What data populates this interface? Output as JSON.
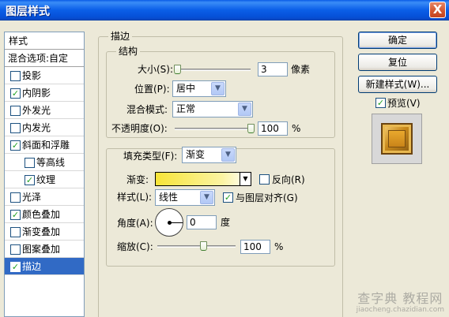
{
  "window": {
    "title": "图层样式",
    "close_glyph": "X"
  },
  "styles_panel": {
    "header": "样式",
    "blend_options": "混合选项:自定",
    "items": [
      {
        "label": "投影",
        "checked": false,
        "sub": false,
        "selected": false
      },
      {
        "label": "内阴影",
        "checked": true,
        "sub": false,
        "selected": false
      },
      {
        "label": "外发光",
        "checked": false,
        "sub": false,
        "selected": false
      },
      {
        "label": "内发光",
        "checked": false,
        "sub": false,
        "selected": false
      },
      {
        "label": "斜面和浮雕",
        "checked": true,
        "sub": false,
        "selected": false
      },
      {
        "label": "等高线",
        "checked": false,
        "sub": true,
        "selected": false
      },
      {
        "label": "纹理",
        "checked": true,
        "sub": true,
        "selected": false
      },
      {
        "label": "光泽",
        "checked": false,
        "sub": false,
        "selected": false
      },
      {
        "label": "颜色叠加",
        "checked": true,
        "sub": false,
        "selected": false
      },
      {
        "label": "渐变叠加",
        "checked": false,
        "sub": false,
        "selected": false
      },
      {
        "label": "图案叠加",
        "checked": false,
        "sub": false,
        "selected": false
      },
      {
        "label": "描边",
        "checked": true,
        "sub": false,
        "selected": true
      }
    ]
  },
  "stroke": {
    "title": "描边",
    "structure": {
      "title": "结构",
      "size_label": "大小(S):",
      "size_value": "3",
      "size_unit": "像素",
      "size_level": 0.02,
      "position_label": "位置(P):",
      "position_value": "居中",
      "blend_label": "混合模式:",
      "blend_value": "正常",
      "opacity_label": "不透明度(O):",
      "opacity_value": "100",
      "opacity_unit": "%",
      "opacity_level": 1.0
    },
    "fill": {
      "type_label": "填充类型(F):",
      "type_value": "渐变",
      "gradient_label": "渐变:",
      "reverse_label": "反向(R)",
      "reverse_checked": false,
      "style_label": "样式(L):",
      "style_value": "线性",
      "align_label": "与图层对齐(G)",
      "align_checked": true,
      "angle_label": "角度(A):",
      "angle_value": "0",
      "angle_unit": "度",
      "scale_label": "缩放(C):",
      "scale_value": "100",
      "scale_unit": "%",
      "scale_level": 0.6
    }
  },
  "buttons": {
    "ok": "确定",
    "reset": "复位",
    "new_style": "新建样式(W)...",
    "preview_label": "预览(V)",
    "preview_checked": true
  },
  "watermark": {
    "main": "查字典 教程网",
    "sub": "jiaocheng.chazidian.com"
  },
  "colors": {
    "titlebar": "#0a5ce6",
    "selected": "#316ac5",
    "dialog_bg": "#ece9d8",
    "gradient_start": "#f7e438"
  }
}
